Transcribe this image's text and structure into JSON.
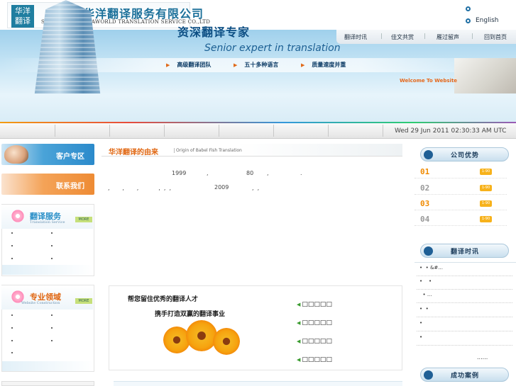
{
  "header": {
    "logo_line1": "华洋",
    "logo_line2": "翻译",
    "company_cn": "深圳市华洋翻译服务有限公司",
    "company_en": "SHENZHEN CHINAWORLD TRANSLATION SERVICE CO.,LTD",
    "lang_option2": "English"
  },
  "nav": {
    "items": [
      "翻译时讯",
      "佳文共赏",
      "雁过留声",
      "回到首页"
    ]
  },
  "banner": {
    "title_cn": "资深翻译专家",
    "title_en": "Senior expert in translation",
    "features": [
      "高级翻译团队",
      "五十多种语言",
      "质量速度并重"
    ],
    "welcome": "Welcome To Website"
  },
  "datebar": {
    "date": "Wed 29 Jun 2011 02:30:33 AM UTC"
  },
  "left": {
    "client": "客户专区",
    "contact": "联系我们",
    "service_title": "翻译服务",
    "service_sub": "Translation Service",
    "field_title": "专业领域",
    "field_sub": "Website Construction",
    "more": "MORE"
  },
  "main": {
    "title": "华洋翻译的由来",
    "subtitle": "Origin of Babel Fish Translation",
    "line1_year": "1999",
    "line1_num": "80",
    "line2_year": "2009",
    "recruit1": "帮您留住优秀的翻译人才",
    "recruit2": "携手打造双赢的翻译事业",
    "links": [
      "□□□□□",
      "□□□□□",
      "□□□□□",
      "□□□□□"
    ]
  },
  "right": {
    "adv_title": "公司优势",
    "adv_nums": [
      "01",
      "02",
      "03",
      "04"
    ],
    "adv_btn": "1-90",
    "news_title": "翻译时讯",
    "news": [
      "&#...",
      "",
      "...",
      "",
      "",
      "",
      ""
    ],
    "more": "......",
    "case_title": "成功案例"
  }
}
